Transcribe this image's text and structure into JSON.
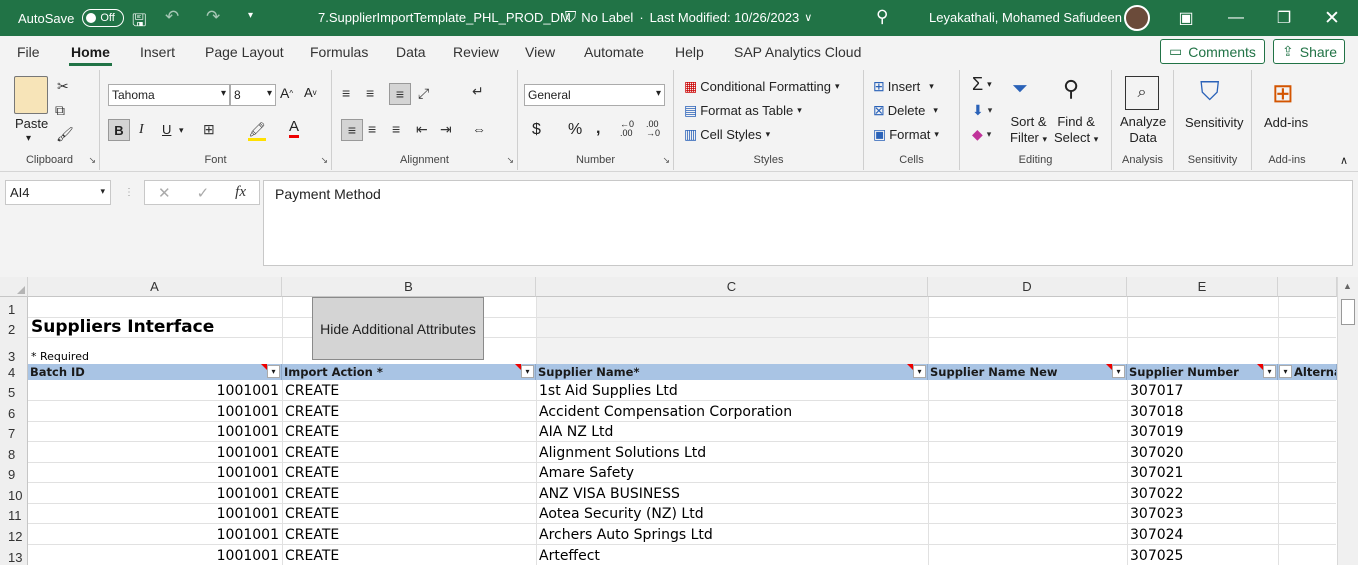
{
  "titlebar": {
    "autosave": "AutoSave",
    "autosave_state": "Off",
    "filename": "7.SupplierImportTemplate_PHL_PROD_DM",
    "label": "No Label",
    "modified": "Last Modified: 10/26/2023",
    "user": "Leyakathali, Mohamed Safiudeen"
  },
  "tabs": [
    "File",
    "Home",
    "Insert",
    "Page Layout",
    "Formulas",
    "Data",
    "Review",
    "View",
    "Automate",
    "Help",
    "SAP Analytics Cloud"
  ],
  "actions": {
    "comments": "Comments",
    "share": "Share"
  },
  "ribbon": {
    "clipboard": {
      "paste": "Paste",
      "label": "Clipboard"
    },
    "font": {
      "name": "Tahoma",
      "size": "8",
      "label": "Font"
    },
    "alignment": {
      "label": "Alignment"
    },
    "number": {
      "format": "General",
      "label": "Number"
    },
    "styles": {
      "conditional": "Conditional Formatting",
      "table": "Format as Table",
      "cell": "Cell Styles",
      "label": "Styles"
    },
    "cells": {
      "insert": "Insert",
      "delete": "Delete",
      "format": "Format",
      "label": "Cells"
    },
    "editing": {
      "sort1": "Sort &",
      "sort2": "Filter",
      "find1": "Find &",
      "find2": "Select",
      "label": "Editing"
    },
    "analysis": {
      "btn1": "Analyze",
      "btn2": "Data",
      "label": "Analysis"
    },
    "sensitivity": {
      "btn": "Sensitivity",
      "label": "Sensitivity"
    },
    "addins": {
      "btn": "Add-ins",
      "label": "Add-ins"
    }
  },
  "formula_bar": {
    "namebox": "AI4",
    "value": "Payment Method"
  },
  "sheet": {
    "columns": [
      "A",
      "B",
      "C",
      "D",
      "E"
    ],
    "row_numbers": [
      "1",
      "2",
      "3",
      "4",
      "5",
      "6",
      "7",
      "8",
      "9",
      "10",
      "11",
      "12",
      "13"
    ],
    "title": "Suppliers Interface",
    "required_note": "* Required",
    "hide_button": "Hide Additional Attributes",
    "headers": [
      "Batch ID",
      "Import Action *",
      "Supplier Name*",
      "Supplier Name New",
      "Supplier Number",
      "Alternate"
    ],
    "rows": [
      [
        "1001001",
        "CREATE",
        "1st Aid Supplies Ltd",
        "",
        "307017"
      ],
      [
        "1001001",
        "CREATE",
        "Accident Compensation Corporation",
        "",
        "307018"
      ],
      [
        "1001001",
        "CREATE",
        "AIA NZ Ltd",
        "",
        "307019"
      ],
      [
        "1001001",
        "CREATE",
        "Alignment Solutions Ltd",
        "",
        "307020"
      ],
      [
        "1001001",
        "CREATE",
        "Amare Safety",
        "",
        "307021"
      ],
      [
        "1001001",
        "CREATE",
        "ANZ VISA BUSINESS",
        "",
        "307022"
      ],
      [
        "1001001",
        "CREATE",
        "Aotea Security (NZ) Ltd",
        "",
        "307023"
      ],
      [
        "1001001",
        "CREATE",
        "Archers Auto Springs Ltd",
        "",
        "307024"
      ],
      [
        "1001001",
        "CREATE",
        "Arteffect",
        "",
        "307025"
      ]
    ]
  }
}
